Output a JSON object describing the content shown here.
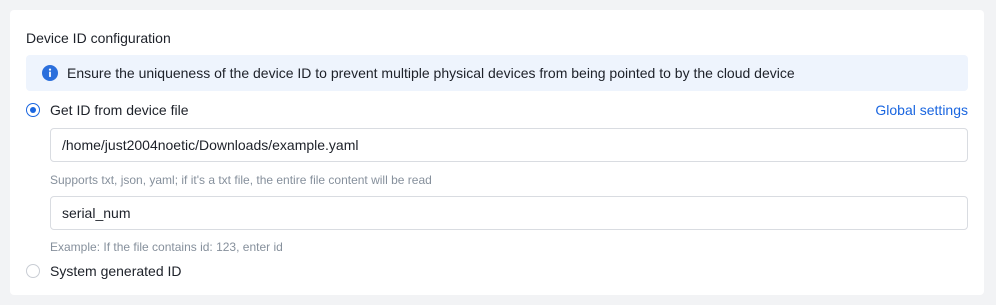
{
  "section": {
    "title": "Device ID configuration"
  },
  "info": {
    "icon": "info-icon",
    "message": "Ensure the uniqueness of the device ID to prevent multiple physical devices from being pointed to by the cloud device"
  },
  "options": {
    "from_file": {
      "label": "Get ID from device file",
      "selected": true
    },
    "system": {
      "label": "System generated ID",
      "selected": false
    }
  },
  "global_settings_link": "Global settings",
  "file_path": {
    "value": "/home/just2004noetic/Downloads/example.yaml",
    "hint": "Supports txt, json, yaml; if it's a txt file, the entire file content will be read"
  },
  "id_key": {
    "value": "serial_num",
    "hint": "Example: If the file contains id: 123, enter id"
  },
  "colors": {
    "accent": "#1a66e0",
    "banner_bg": "#eef4fd",
    "page_bg": "#f2f3f5"
  }
}
